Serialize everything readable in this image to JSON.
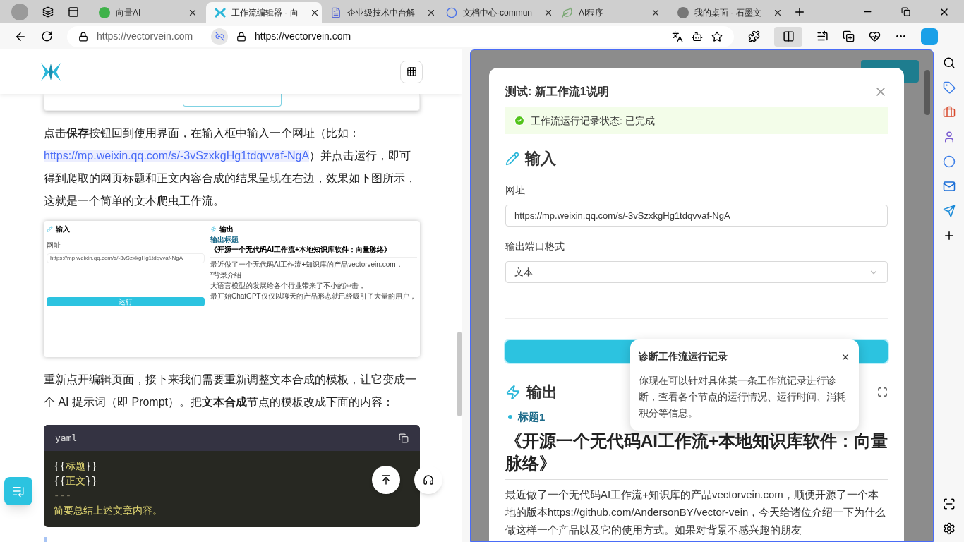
{
  "browser": {
    "tabs": [
      {
        "title": "向量AI",
        "selected": false
      },
      {
        "title": "工作流编辑器 - 向",
        "selected": true
      },
      {
        "title": "企业级技术中台解",
        "selected": false
      },
      {
        "title": "文档中心-commun",
        "selected": false
      },
      {
        "title": "AI程序",
        "selected": false
      },
      {
        "title": "我的桌面 - 石墨文",
        "selected": false
      }
    ],
    "address_left": "https://vectorvein.com",
    "address_right": "https://vectorvein.com"
  },
  "article": {
    "para1": {
      "before": "点击**保存**按钮回到使用界面，在输入框中输入一个网址（比如：",
      "link": "https://mp.weixin.qq.com/s/-3vSzxkgHg1tdqvvaf-NgA",
      "after": "）并点击运行，即可得到爬取的网页标题和正文内容合成的结果呈现在右边，效果如下图所示，这就是一个简单的文本爬虫工作流。"
    },
    "figure": {
      "input_heading": "输入",
      "url_label": "网址",
      "url_value": "https://mp.weixin.qq.com/s/-3vSzxkgHg1tdqvvaf-NgA",
      "run_button": "运行",
      "output_heading": "输出",
      "output_label": "输出标题",
      "output_title": "《开源一个无代码AI工作流+本地知识库软件：向量脉络》",
      "paragraphs": [
        "最近做了一个无代码AI工作流+知识库的产品vectorvein.com，",
        "*背景介绍",
        "大语言模型的发展给各个行业带来了不小的冲击，",
        "最开始ChatGPT仅仅以聊天的产品形态就已经吸引了大量的用户，"
      ]
    },
    "para2": "重新点开编辑页面，接下来我们需要重新调整文本合成的模板，让它变成一个 AI 提示词（即 Prompt）。把**文本合成**节点的模板改成下面的内容：",
    "code": {
      "language": "yaml",
      "lines": [
        {
          "kind": "variable",
          "text": "{{标题}}"
        },
        {
          "kind": "variable",
          "text": "{{正文}}"
        },
        {
          "kind": "separator",
          "text": "---"
        },
        {
          "kind": "text",
          "text": "简要总结上述文章内容。"
        }
      ]
    }
  },
  "workflow_dialog": {
    "title": "测试: 新工作流1说明",
    "status": "工作流运行记录状态: 已完成",
    "input_heading": "输入",
    "fields": [
      {
        "kind": "input",
        "label": "网址",
        "value": "https://mp.weixin.qq.com/s/-3vSzxkgHg1tdqvvaf-NgA"
      },
      {
        "kind": "select",
        "label": "输出端口格式",
        "value": "文本"
      }
    ],
    "output_heading": "输出",
    "output_label": "标题1",
    "output_title": "《开源一个无代码AI工作流+本地知识库软件：向量脉络》",
    "output_text": "最近做了一个无代码AI工作流+知识库的产品vectorvein.com，顺便开源了一个本地的版本https://github.com/AndersonBY/vector-vein，今天给诸位介绍一下为什么做这样一个产品以及它的使用方式。如果对背景不感兴趣的朋友"
  },
  "popover": {
    "title": "诊断工作流运行记录",
    "body": "你现在可以针对具体某一条工作流记录进行诊断，查看各个节点的运行情况、运行时间、消耗积分等信息。"
  }
}
